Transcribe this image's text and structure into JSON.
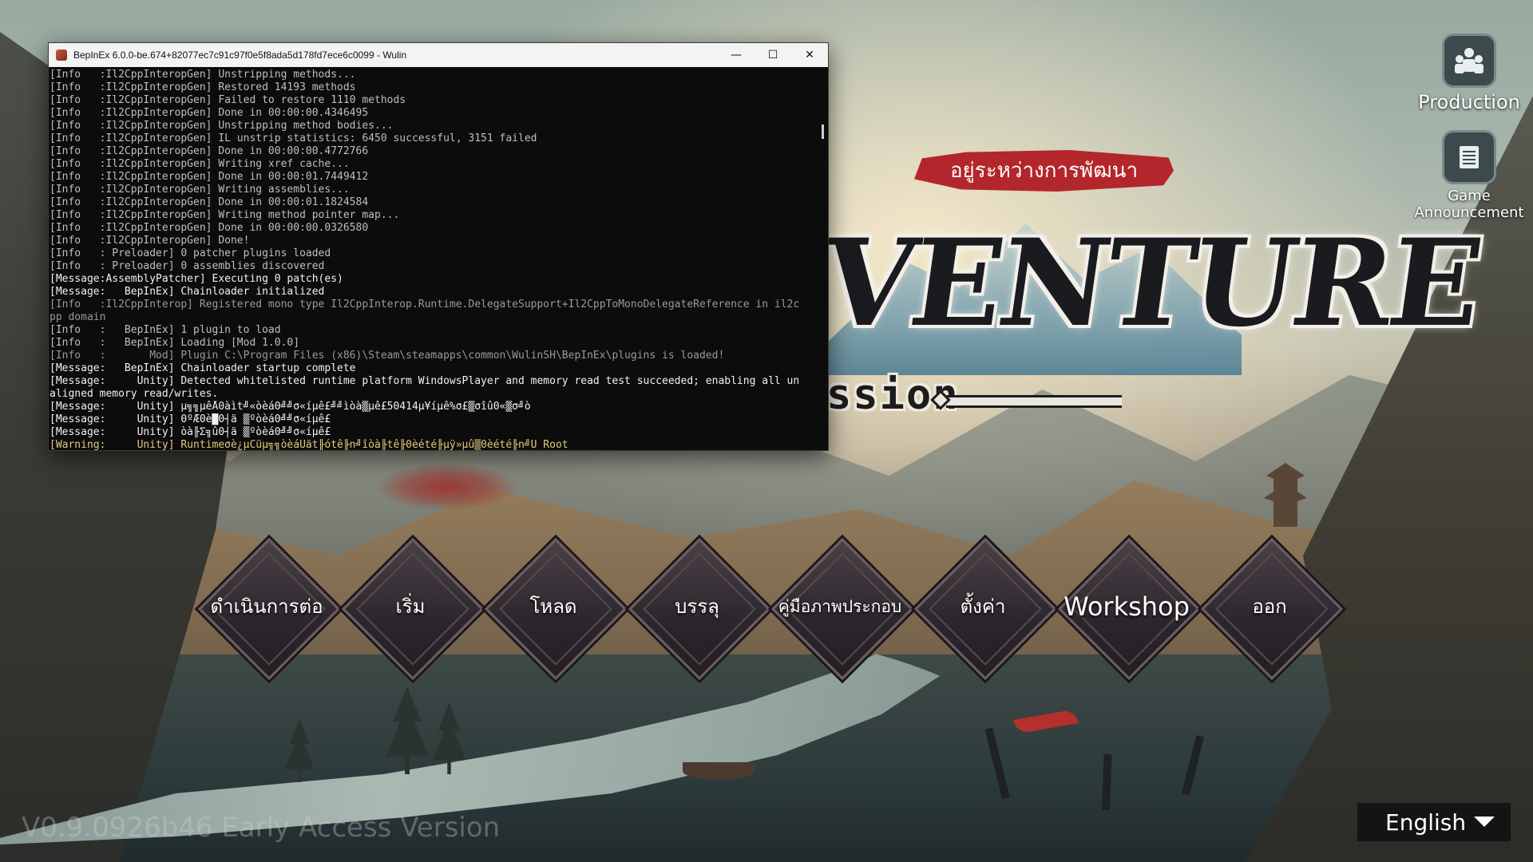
{
  "console": {
    "title": "BepInEx 6.0.0-be.674+82077ec7c91c97f0e5f8ada5d178fd7ece6c0099 - Wulin",
    "controls": {
      "minimize": "—",
      "maximize": "☐",
      "close": "✕"
    },
    "lines": [
      {
        "text": "[Info   :Il2CppInteropGen] Unstripping methods...",
        "kind": "info"
      },
      {
        "text": "[Info   :Il2CppInteropGen] Restored 14193 methods",
        "kind": "info"
      },
      {
        "text": "[Info   :Il2CppInteropGen] Failed to restore 1110 methods",
        "kind": "info"
      },
      {
        "text": "[Info   :Il2CppInteropGen] Done in 00:00:00.4346495",
        "kind": "info"
      },
      {
        "text": "[Info   :Il2CppInteropGen] Unstripping method bodies...",
        "kind": "info"
      },
      {
        "text": "[Info   :Il2CppInteropGen] IL unstrip statistics: 6450 successful, 3151 failed",
        "kind": "info"
      },
      {
        "text": "[Info   :Il2CppInteropGen] Done in 00:00:00.4772766",
        "kind": "info"
      },
      {
        "text": "[Info   :Il2CppInteropGen] Writing xref cache...",
        "kind": "info"
      },
      {
        "text": "[Info   :Il2CppInteropGen] Done in 00:00:01.7449412",
        "kind": "info"
      },
      {
        "text": "[Info   :Il2CppInteropGen] Writing assemblies...",
        "kind": "info"
      },
      {
        "text": "[Info   :Il2CppInteropGen] Done in 00:00:01.1824584",
        "kind": "info"
      },
      {
        "text": "[Info   :Il2CppInteropGen] Writing method pointer map...",
        "kind": "info"
      },
      {
        "text": "[Info   :Il2CppInteropGen] Done in 00:00:00.0326580",
        "kind": "info"
      },
      {
        "text": "[Info   :Il2CppInteropGen] Done!",
        "kind": "info"
      },
      {
        "text": "[Info   : Preloader] 0 patcher plugins loaded",
        "kind": "info"
      },
      {
        "text": "[Info   : Preloader] 0 assemblies discovered",
        "kind": "info"
      },
      {
        "text": "[Message:AssemblyPatcher] Executing 0 patch(es)",
        "kind": "msg"
      },
      {
        "text": "[Message:   BepInEx] Chainloader initialized",
        "kind": "msg"
      },
      {
        "text": "[Info   :Il2CppInterop] Registered mono type Il2CppInterop.Runtime.DelegateSupport+Il2CppToMonoDelegateReference in il2c",
        "kind": "dim"
      },
      {
        "text": "pp domain",
        "kind": "dim"
      },
      {
        "text": "[Info   :   BepInEx] 1 plugin to load",
        "kind": "info"
      },
      {
        "text": "[Info   :   BepInEx] Loading [Mod 1.0.0]",
        "kind": "info"
      },
      {
        "text": "[Info   :       Mod] Plugin C:\\Program Files (x86)\\Steam\\steamapps\\common\\WulinSH\\BepInEx\\plugins is loaded!",
        "kind": "dim"
      },
      {
        "text": "[Message:   BepInEx] Chainloader startup complete",
        "kind": "msg"
      },
      {
        "text": "[Message:     Unity] Detected whitelisted runtime platform WindowsPlayer and memory read test succeeded; enabling all un",
        "kind": "msg"
      },
      {
        "text": "aligned memory read/writes.",
        "kind": "msg"
      },
      {
        "text": "[Message:     Unity] µ╗╗µêÅ0àìt╝«òèá0╝╝σ«íµê£╝╝ìòà▒µê£50414µ¥íµê%σ£▒σîû0«▒σ╝ò",
        "kind": "msg"
      },
      {
        "text": "[Message:     Unity] 0ºÆ0è█0┤ä ▒ºòèá0╝╝σ«íµê£",
        "kind": "msg"
      },
      {
        "text": "[Message:     Unity] òà╟Σ╗û0┤ä ▒ºòèá0╝╝σ«íµê£",
        "kind": "msg"
      },
      {
        "text": "[Warning:     Unity] Runtimeσè¿µCüµ╗╗òèáÜät╟ótê╟n╝îòà╟tê╟0èété╟µÿ»µû▒0èété╟n╝Ü Root",
        "kind": "warn"
      }
    ]
  },
  "logo": {
    "dev_banner": "อยู่ระหว่างการพัฒนา",
    "title_fragment": "VENTURE",
    "subtitle_fragment": "ssion"
  },
  "side": {
    "production": {
      "label": "Production",
      "icon": "team-icon"
    },
    "announcement": {
      "label": "Game Announcement",
      "icon": "scroll-icon"
    }
  },
  "menu": [
    {
      "label": "ดำเนินการต่อ",
      "name": "continue"
    },
    {
      "label": "เริ่ม",
      "name": "start"
    },
    {
      "label": "โหลด",
      "name": "load"
    },
    {
      "label": "บรรลุ",
      "name": "achievements"
    },
    {
      "label": "คู่มือภาพประกอบ",
      "name": "illustrated-guide"
    },
    {
      "label": "ตั้งค่า",
      "name": "settings"
    },
    {
      "label": "Workshop",
      "name": "workshop"
    },
    {
      "label": "ออก",
      "name": "exit"
    }
  ],
  "version": "V0.9.0926b46 Early Access Version",
  "language": {
    "selected": "English"
  }
}
